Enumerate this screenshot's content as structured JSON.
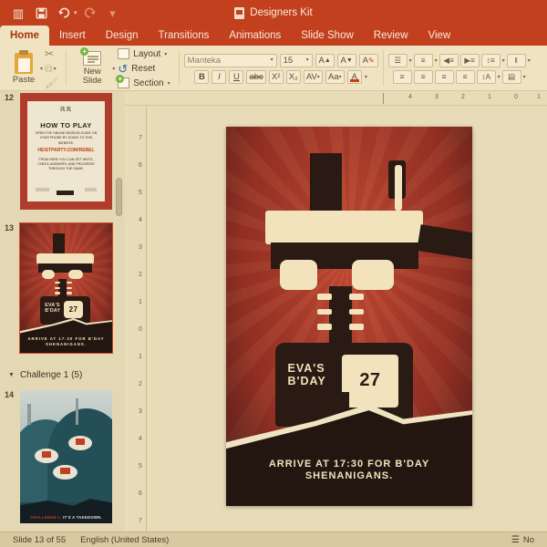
{
  "titlebar": {
    "document_title": "Designers Kit",
    "buttons": [
      {
        "name": "sidebar-toggle",
        "glyph": "◫"
      },
      {
        "name": "save",
        "glyph": "💾"
      },
      {
        "name": "undo",
        "glyph": "↶"
      },
      {
        "name": "redo",
        "glyph": "↷"
      },
      {
        "name": "customize-toolbar",
        "glyph": "▾"
      }
    ]
  },
  "tabs": [
    {
      "label": "Home",
      "active": true
    },
    {
      "label": "Insert",
      "active": false
    },
    {
      "label": "Design",
      "active": false
    },
    {
      "label": "Transitions",
      "active": false
    },
    {
      "label": "Animations",
      "active": false
    },
    {
      "label": "Slide Show",
      "active": false
    },
    {
      "label": "Review",
      "active": false
    },
    {
      "label": "View",
      "active": false
    }
  ],
  "ribbon": {
    "paste_label": "Paste",
    "new_slide_label_line1": "New",
    "new_slide_label_line2": "Slide",
    "slide_actions": [
      {
        "label": "Layout",
        "has_caret": true
      },
      {
        "label": "Reset",
        "has_caret": false
      },
      {
        "label": "Section",
        "has_caret": true
      }
    ],
    "font": {
      "name": "Manteka",
      "size": "15",
      "grow_label": "A",
      "shrink_label": "A",
      "clear_format_label": "A",
      "bold": "B",
      "italic": "I",
      "underline": "U",
      "strikethrough": "abc",
      "superscript": "X²",
      "subscript": "X₂",
      "char_spacing": "AV",
      "change_case": "Aa",
      "font_color": "A",
      "font_color_hex": "#c2401d"
    },
    "paragraph": {
      "bullets": "☰",
      "numbering": "≡",
      "decrease_indent": "◀≡",
      "increase_indent": "▶≡",
      "line_spacing": "↕≡",
      "columns": "‖",
      "align_left": "≡",
      "align_center": "≡",
      "align_right": "≡",
      "justify": "≡",
      "text_direction": "↕A",
      "align_text": "▤"
    }
  },
  "thumbnails": {
    "slides": [
      {
        "number": "12",
        "selected": false,
        "kind": "howtoplay",
        "heading": "HOW TO PLAY",
        "body1": "OPEN THE ONLINE MISSION GUIDE ON YOUR PHONE BY GOING TO THIS WEBSITE:",
        "url": "HEISTPARTY.COM/REBEL",
        "body2": "FROM HERE YOU CAN GET HINTS, CHECK ANSWERS, AND PROGRESS THROUGH THE GAME.",
        "logo": "ℝℝ"
      },
      {
        "number": "13",
        "selected": true,
        "kind": "drill",
        "badge_line1": "EVA'S",
        "badge_line2": "B'DAY",
        "badge_number": "27",
        "caption": "ARRIVE AT 17:30 FOR B'DAY SHENANIGANS."
      },
      {
        "number": "14",
        "selected": false,
        "kind": "challenge",
        "caption_accent": "CHALLENGE 1:",
        "caption": "IT'S A TAKEDOWN."
      }
    ],
    "section": {
      "label": "Challenge 1 (5)",
      "expanded": true,
      "triangle": "▼"
    }
  },
  "rulers": {
    "horizontal_ticks": [
      "4",
      "3",
      "2",
      "1",
      "0",
      "1"
    ],
    "vertical_ticks": [
      "7",
      "6",
      "5",
      "4",
      "3",
      "2",
      "1",
      "0",
      "1",
      "2",
      "3",
      "4",
      "5",
      "6",
      "7"
    ]
  },
  "slide": {
    "badge_line1": "EVA'S",
    "badge_line2": "B'DAY",
    "badge_number": "27",
    "caption_line1": "ARRIVE AT 17:30 FOR B'DAY",
    "caption_line2": "SHENANIGANS.",
    "background_hex": "#b03c2c",
    "ink_hex": "#2a1a14",
    "cream_hex": "#f2e3bd"
  },
  "statusbar": {
    "slide_position": "Slide 13 of 55",
    "language": "English (United States)",
    "notes_label": "No",
    "notes_icon": "☰"
  },
  "theme": {
    "accent_hex": "#c2401d",
    "ribbon_hex": "#efe3c2",
    "workspace_hex": "#e8dcb8",
    "status_hex": "#d8c9a0"
  }
}
